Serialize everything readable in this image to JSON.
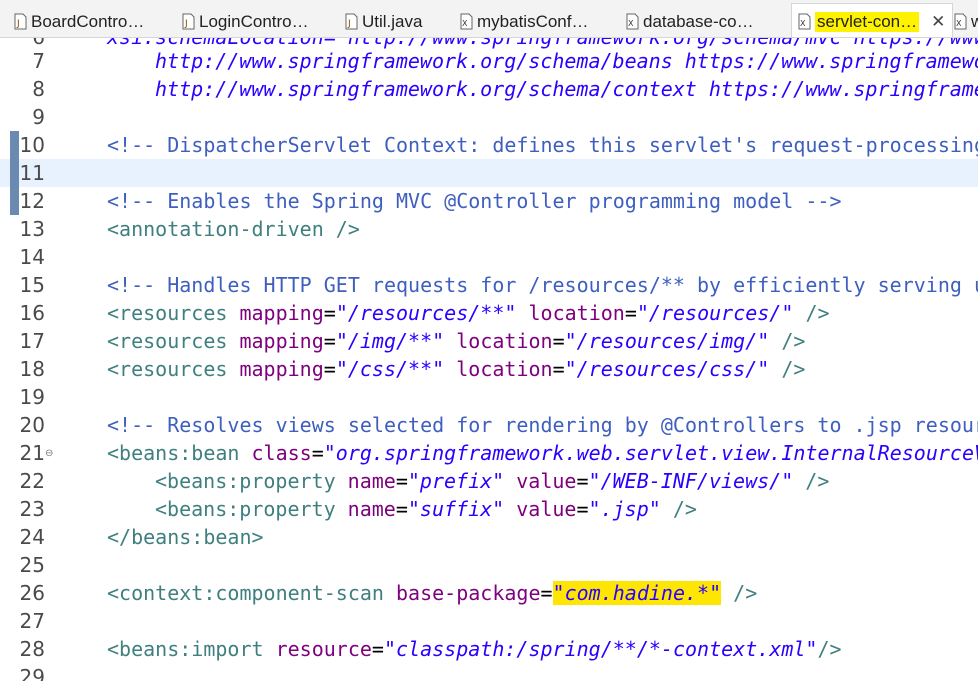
{
  "tabs": [
    {
      "label": "BoardContro…",
      "icon": "java-file-icon"
    },
    {
      "label": "LoginContro…",
      "icon": "java-file-icon"
    },
    {
      "label": "Util.java",
      "icon": "java-file-icon"
    },
    {
      "label": "mybatisConf…",
      "icon": "xml-file-icon"
    },
    {
      "label": "database-co…",
      "icon": "xml-file-icon"
    },
    {
      "label": "servlet-con…",
      "icon": "xml-file-icon",
      "active": true
    },
    {
      "label": "w",
      "icon": "xml-file-icon"
    }
  ],
  "close_glyph": "✕",
  "lines": {
    "l6": {
      "num": "6",
      "text": "xsi:schemaLocation=\"http://www.springframework.org/schema/mvc https://www"
    },
    "l7": {
      "num": "7",
      "text": "http://www.springframework.org/schema/beans https://www.springframewo"
    },
    "l8": {
      "num": "8",
      "text": "http://www.springframework.org/schema/context https://www.springframe"
    },
    "l9": {
      "num": "9"
    },
    "l10": {
      "num": "10",
      "text": "<!-- DispatcherServlet Context: defines this servlet's request-processing"
    },
    "l11": {
      "num": "11"
    },
    "l12": {
      "num": "12",
      "text": "<!-- Enables the Spring MVC @Controller programming model -->"
    },
    "l13": {
      "num": "13",
      "tag": "<annotation-driven",
      "end": " />"
    },
    "l14": {
      "num": "14"
    },
    "l15": {
      "num": "15",
      "text": "<!-- Handles HTTP GET requests for /resources/** by efficiently serving u"
    },
    "l16": {
      "num": "16",
      "tag": "<resources",
      "attr1": "mapping",
      "val1": "\"/resources/**\"",
      "attr2": "location",
      "val2": "\"/resources/\"",
      "end": " />"
    },
    "l17": {
      "num": "17",
      "tag": "<resources",
      "attr1": "mapping",
      "val1": "\"/img/**\"",
      "attr2": "location",
      "val2": "\"/resources/img/\"",
      "end": " />"
    },
    "l18": {
      "num": "18",
      "tag": "<resources",
      "attr1": "mapping",
      "val1": "\"/css/**\"",
      "attr2": "location",
      "val2": "\"/resources/css/\"",
      "end": " />"
    },
    "l19": {
      "num": "19"
    },
    "l20": {
      "num": "20",
      "text": "<!-- Resolves views selected for rendering by @Controllers to .jsp resour"
    },
    "l21": {
      "num": "21",
      "tag": "<beans:bean",
      "attr1": "class",
      "val1": "\"org.springframework.web.servlet.view.InternalResourceV"
    },
    "l22": {
      "num": "22",
      "tag": "<beans:property",
      "attr1": "name",
      "val1": "\"prefix\"",
      "attr2": "value",
      "val2": "\"/WEB-INF/views/\"",
      "end": " />"
    },
    "l23": {
      "num": "23",
      "tag": "<beans:property",
      "attr1": "name",
      "val1": "\"suffix\"",
      "attr2": "value",
      "val2": "\".jsp\"",
      "end": " />"
    },
    "l24": {
      "num": "24",
      "tag": "</beans:bean>"
    },
    "l25": {
      "num": "25"
    },
    "l26": {
      "num": "26",
      "tag": "<context:component-scan",
      "attr1": "base-package",
      "val1": "\"com.hadine.*\"",
      "end": " />"
    },
    "l27": {
      "num": "27"
    },
    "l28": {
      "num": "28",
      "tag": "<beans:import",
      "attr1": "resource",
      "val1": "\"classpath:/spring/**/*-context.xml\"",
      "end": "/>"
    },
    "l29": {
      "num": "29"
    }
  },
  "colors": {
    "comment": "#3f5fbf",
    "tag": "#3f7f7f",
    "attribute": "#7f007f",
    "string": "#2a00ff",
    "highlight": "#ffe600",
    "current_line": "#e8f2fe"
  }
}
